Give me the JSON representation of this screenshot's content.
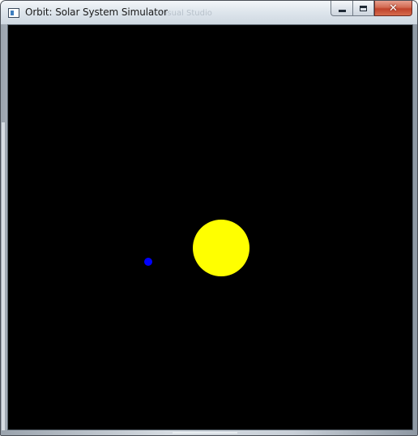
{
  "window": {
    "title": "Orbit: Solar System Simulator",
    "background_title_ghost": "Visual Studio"
  },
  "controls": {
    "minimize_icon": "minimize-icon",
    "maximize_icon": "maximize-icon",
    "close_icon": "close-icon",
    "close_glyph": "✕"
  },
  "scene": {
    "background_color": "#000000",
    "sun_color": "#ffff00",
    "planet_color": "#0000ff"
  }
}
